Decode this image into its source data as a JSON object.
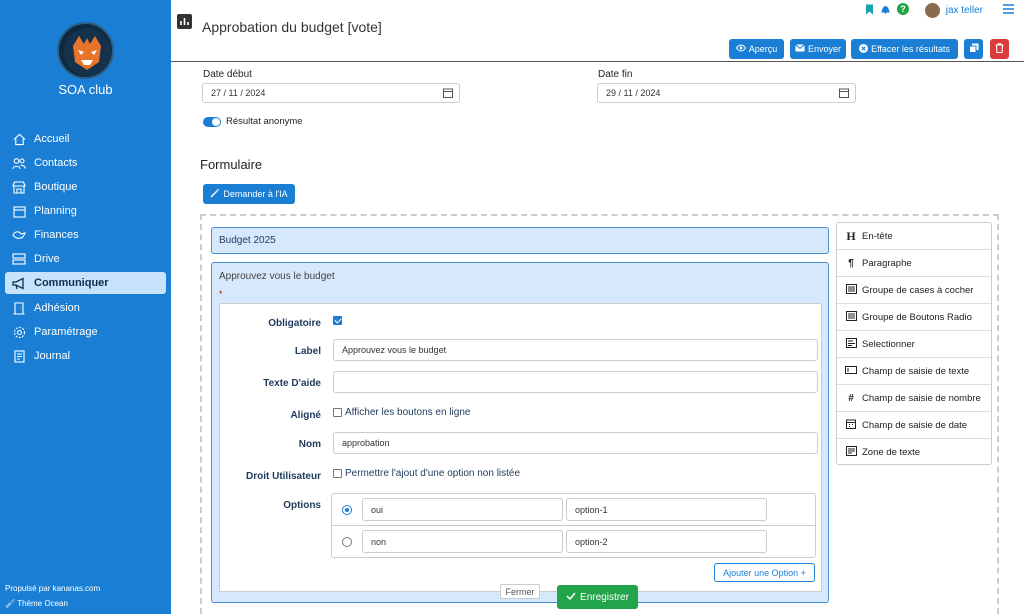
{
  "sidebar": {
    "club_name": "SOA club",
    "items": [
      {
        "label": "Accueil",
        "icon": "home-icon"
      },
      {
        "label": "Contacts",
        "icon": "users-icon"
      },
      {
        "label": "Boutique",
        "icon": "shop-icon"
      },
      {
        "label": "Planning",
        "icon": "calendar-icon"
      },
      {
        "label": "Finances",
        "icon": "money-icon"
      },
      {
        "label": "Drive",
        "icon": "drive-icon"
      },
      {
        "label": "Communiquer",
        "icon": "megaphone-icon",
        "active": true
      },
      {
        "label": "Adhésion",
        "icon": "door-icon"
      },
      {
        "label": "Paramétrage",
        "icon": "gear-icon"
      },
      {
        "label": "Journal",
        "icon": "journal-icon"
      }
    ],
    "footer_powered": "Propulsé par kananas.com",
    "footer_theme": "Thème Ocean"
  },
  "header": {
    "title": "Approbation du budget [vote]",
    "user_name": "jax teller",
    "buttons": {
      "preview": "Aperçu",
      "send": "Envoyer",
      "clear": "Effacer les résultats"
    }
  },
  "dates": {
    "start_label": "Date début",
    "start_value": "27 / 11 / 2024",
    "end_label": "Date fin",
    "end_value": "29 / 11 / 2024"
  },
  "anonymous_label": "Résultat anonyme",
  "form": {
    "section_title": "Formulaire",
    "ai_button": "Demander à l'IA",
    "header_field": "Budget 2025",
    "radio_field_label": "Approuvez vous le budget",
    "required_mark": "*",
    "editor": {
      "required_label": "Obligatoire",
      "label_label": "Label",
      "label_value": "Approuvez vous le budget",
      "help_label": "Texte D'aide",
      "help_value": "",
      "inline_label": "Aligné",
      "inline_text": "Afficher les boutons en ligne",
      "name_label": "Nom",
      "name_value": "approbation",
      "user_right_label": "Droit Utilisateur",
      "user_right_text": "Permettre l'ajout d'une option non listée",
      "options_label": "Options",
      "options": [
        {
          "label": "oui",
          "value": "option-1",
          "selected": true
        },
        {
          "label": "non",
          "value": "option-2",
          "selected": false
        }
      ],
      "add_option": "Ajouter une Option +",
      "close": "Fermer",
      "save": "Enregistrer"
    }
  },
  "palette": [
    {
      "label": "En-tête",
      "icon": "heading-icon"
    },
    {
      "label": "Paragraphe",
      "icon": "paragraph-icon"
    },
    {
      "label": "Groupe de cases à cocher",
      "icon": "checkbox-list-icon"
    },
    {
      "label": "Groupe de Boutons Radio",
      "icon": "radio-list-icon"
    },
    {
      "label": "Selectionner",
      "icon": "select-icon"
    },
    {
      "label": "Champ de saisie de texte",
      "icon": "text-input-icon"
    },
    {
      "label": "Champ de saisie de nombre",
      "icon": "hash-icon"
    },
    {
      "label": "Champ de saisie de date",
      "icon": "calendar-icon"
    },
    {
      "label": "Zone de texte",
      "icon": "textarea-icon"
    }
  ],
  "colors": {
    "primary": "#1a7fd4",
    "danger": "#d93b3b",
    "success": "#22a44a",
    "active_bg": "#c7e2fb"
  }
}
